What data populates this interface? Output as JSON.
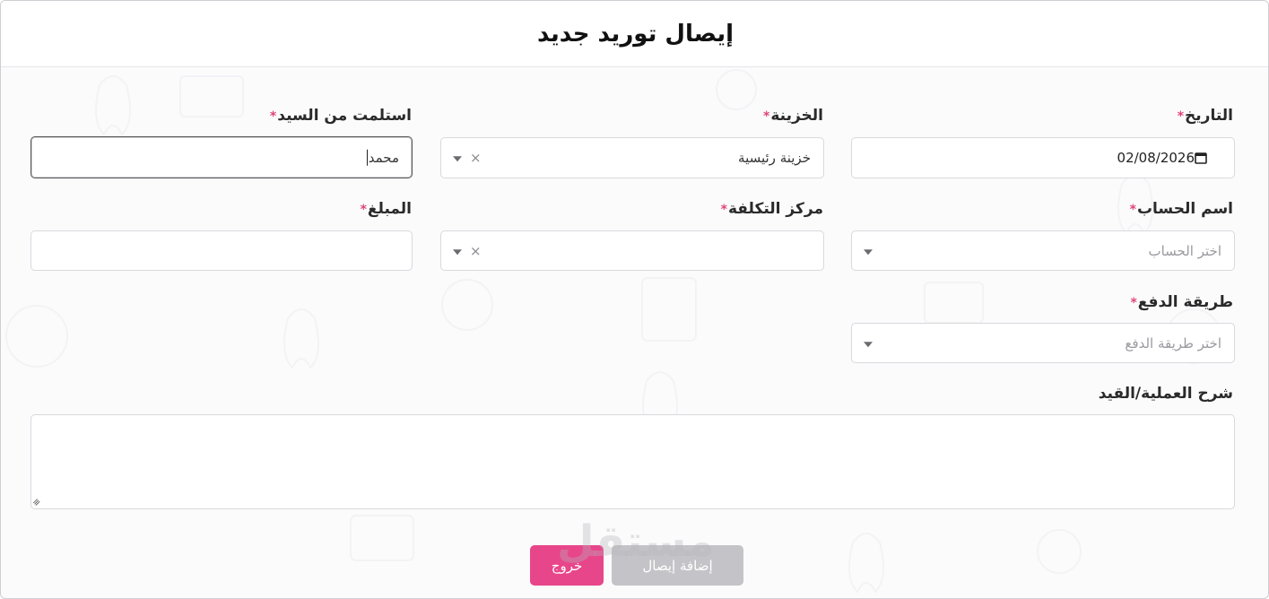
{
  "dialog": {
    "title": "إيصال توريد جديد"
  },
  "fields": {
    "date": {
      "label": "التاريخ",
      "required_mark": "*",
      "value": "02/08/2026"
    },
    "treasury": {
      "label": "الخزينة",
      "required_mark": "*",
      "value": "خزينة رئيسية",
      "clear": "×"
    },
    "received_from": {
      "label": "استلمت من السيد",
      "required_mark": "*",
      "value": "محمد"
    },
    "account": {
      "label": "اسم الحساب",
      "required_mark": "*",
      "placeholder": "اختر الحساب"
    },
    "cost_center": {
      "label": "مركز التكلفة",
      "required_mark": "*",
      "clear": "×"
    },
    "amount": {
      "label": "المبلغ",
      "required_mark": "*",
      "value": ""
    },
    "payment_method": {
      "label": "طريقة الدفع",
      "required_mark": "*",
      "placeholder": "اختر طريقة الدفع"
    },
    "description": {
      "label": "شرح العملية/القيد",
      "value": ""
    }
  },
  "buttons": {
    "exit": "خروج",
    "add_receipt": "إضافة إيصال"
  },
  "watermark": "مستقل",
  "colors": {
    "accent": "#e8468a",
    "disabled": "#c4c4c8",
    "required": "#e0457b"
  }
}
